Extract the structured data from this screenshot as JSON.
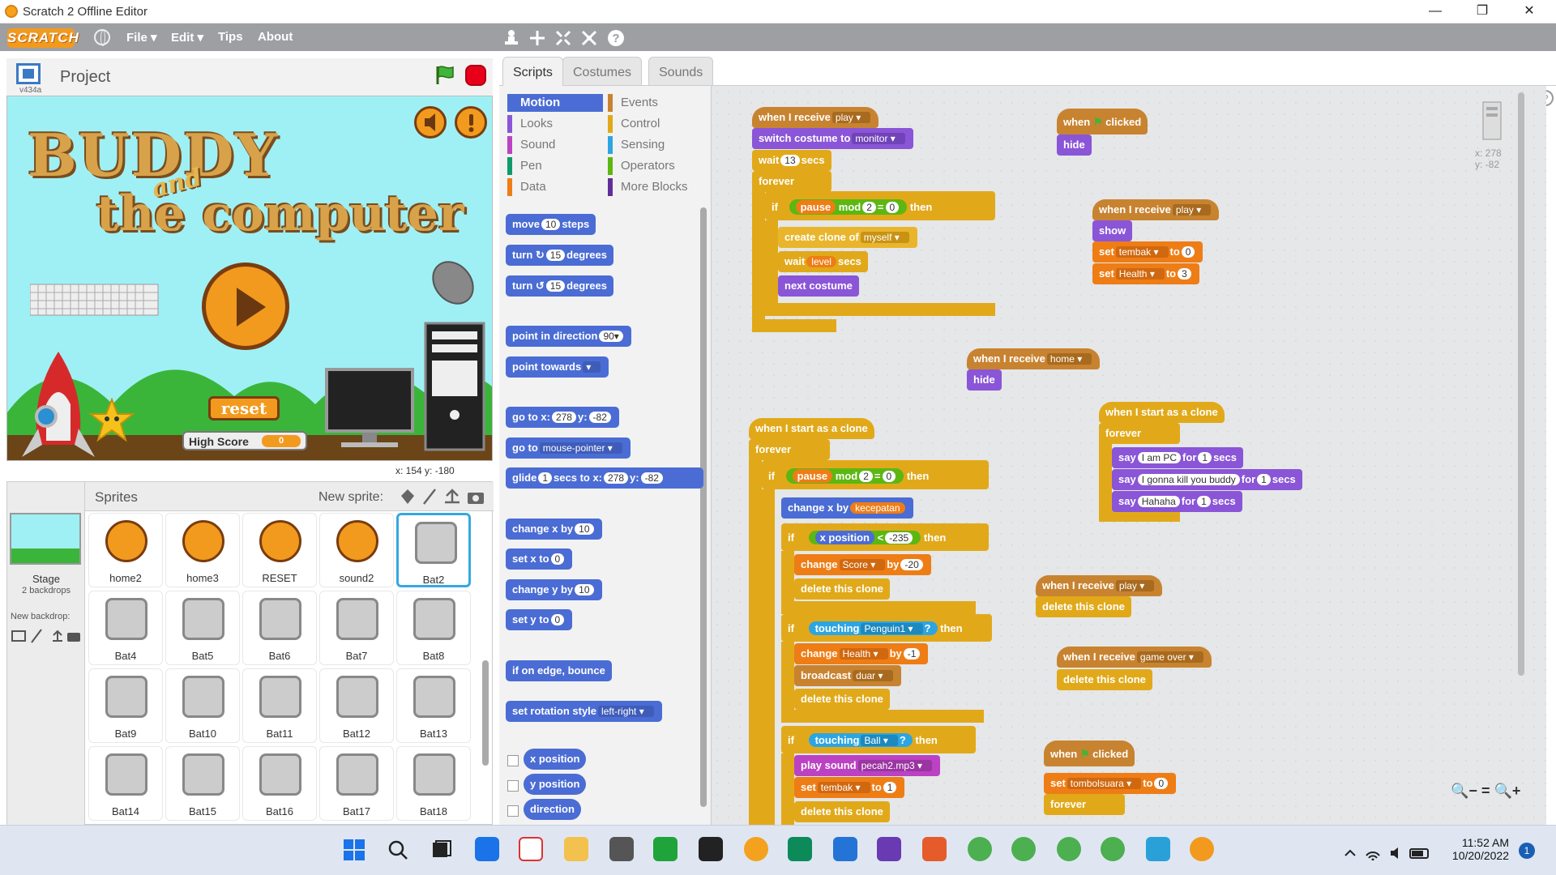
{
  "window": {
    "title": "Scratch 2 Offline Editor",
    "minimize": "—",
    "maximize": "❐",
    "close": "✕"
  },
  "menu": {
    "logo": "SCRATCH",
    "file": "File ▾",
    "edit": "Edit ▾",
    "tips": "Tips",
    "about": "About"
  },
  "toolbar": {
    "help": "?"
  },
  "stage_header": {
    "version": "v434a",
    "project": "Project"
  },
  "stage": {
    "title1": "BUDDY",
    "title_and": "and",
    "title2": "the computer",
    "reset": "reset",
    "high_score_label": "High Score",
    "high_score_value": "0",
    "coords": "x: 154   y: -180"
  },
  "sprites_panel": {
    "title": "Sprites",
    "new_sprite": "New sprite:",
    "stage_label": "Stage",
    "stage_sub": "2 backdrops",
    "new_backdrop": "New backdrop:",
    "sprites": [
      "home2",
      "home3",
      "RESET",
      "sound2",
      "Bat2",
      "Bat4",
      "Bat5",
      "Bat6",
      "Bat7",
      "Bat8",
      "Bat9",
      "Bat10",
      "Bat11",
      "Bat12",
      "Bat13",
      "Bat14",
      "Bat15",
      "Bat16",
      "Bat17",
      "Bat18"
    ],
    "selected": "Bat2"
  },
  "tabs": [
    "Scripts",
    "Costumes",
    "Sounds"
  ],
  "categories": {
    "left": [
      "Motion",
      "Looks",
      "Sound",
      "Pen",
      "Data"
    ],
    "right": [
      "Events",
      "Control",
      "Sensing",
      "Operators",
      "More Blocks"
    ],
    "colors": {
      "Motion": "#4a6cd4",
      "Looks": "#8a55d7",
      "Sound": "#bb42c3",
      "Pen": "#0e9a6c",
      "Data": "#ee7d16",
      "Events": "#c88330",
      "Control": "#e1a91a",
      "Sensing": "#2ca5e2",
      "Operators": "#5cb712",
      "More Blocks": "#632d99"
    }
  },
  "palette_blocks": {
    "move": "move",
    "move_n": "10",
    "steps": "steps",
    "turn_r": "turn ↻",
    "turn_r_n": "15",
    "degrees": "degrees",
    "turn_l": "turn ↺",
    "turn_l_n": "15",
    "point_dir": "point in direction",
    "point_dir_n": "90▾",
    "point_towards": "point towards",
    "goto_xy": "go to x:",
    "goto_x": "278",
    "y": "y:",
    "goto_y": "-82",
    "goto": "go to",
    "goto_target": "mouse-pointer ▾",
    "glide": "glide",
    "glide_n": "1",
    "glide_secs": "secs to x:",
    "glide_x": "278",
    "glide_y": "-82",
    "change_x": "change x by",
    "change_x_n": "10",
    "set_x": "set x to",
    "set_x_n": "0",
    "change_y": "change y by",
    "change_y_n": "10",
    "set_y": "set y to",
    "set_y_n": "0",
    "bounce": "if on edge, bounce",
    "rot_style": "set rotation style",
    "rot_style_v": "left-right ▾",
    "x_pos": "x position",
    "y_pos": "y position",
    "direction": "direction"
  },
  "scripts": {
    "s1_hat": "when I receive",
    "s1_hat_v": "play ▾",
    "s1_costume": "switch costume to",
    "s1_costume_v": "monitor ▾",
    "s1_wait": "wait",
    "s1_wait_n": "13",
    "secs": "secs",
    "forever": "forever",
    "if": "if",
    "then": "then",
    "pause": "pause",
    "mod": "mod",
    "two": "2",
    "eq": "=",
    "zero": "0",
    "create_clone": "create clone of",
    "myself": "myself ▾",
    "wait": "wait",
    "level": "level",
    "next_costume": "next costume",
    "s2_hat": "when",
    "clicked": "clicked",
    "hide": "hide",
    "s3_hat_v": "play ▾",
    "show": "show",
    "set": "set",
    "tembak": "tembak ▾",
    "to": "to",
    "tembak_v": "0",
    "health": "Health ▾",
    "health_v": "3",
    "s4_hat_v": "home ▾",
    "clone_hat": "when I start as a clone",
    "say": "say",
    "for": "for",
    "say1": "I am PC",
    "say2": "I gonna kill you buddy",
    "say3": "Hahaha",
    "one": "1",
    "change_x_by": "change x by",
    "kecepatan": "kecepatan",
    "x_position": "x position",
    "lt": "<",
    "neg235": "-235",
    "change": "change",
    "score": "Score ▾",
    "by": "by",
    "neg20": "-20",
    "delete_clone": "delete this clone",
    "touching": "touching",
    "penguin": "Penguin1 ▾",
    "q": "?",
    "neg1": "-1",
    "broadcast": "broadcast",
    "duar": "duar ▾",
    "ball": "Ball ▾",
    "play_sound": "play sound",
    "pecah": "pecah2.mp3 ▾",
    "tembak_1": "1",
    "s6_hat_v": "play ▾",
    "s7_hat_v": "game over ▾",
    "tombol": "tombolsuara ▾",
    "tombol_v": "0",
    "sprite_xy": "x: 278\ny: -82",
    "zoom_out": "🔍−",
    "zoom_reset": "=",
    "zoom_in": "🔍+"
  },
  "taskbar": {
    "time": "11:52 AM",
    "date": "10/20/2022",
    "badge": "1"
  }
}
